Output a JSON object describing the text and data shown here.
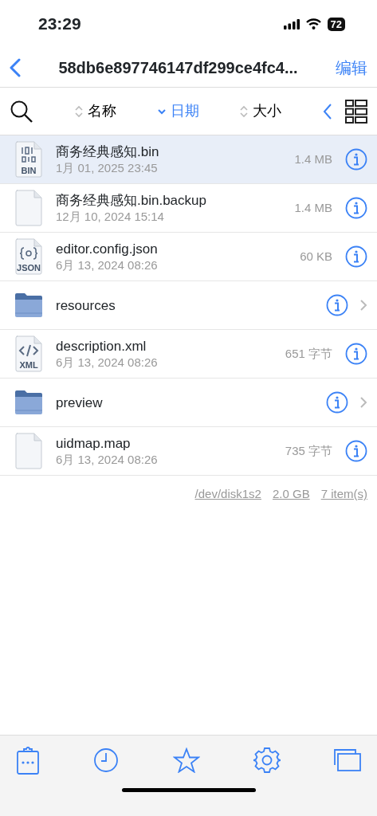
{
  "status_bar": {
    "time": "23:29",
    "battery": "72"
  },
  "nav": {
    "title": "58db6e897746147df299ce4fc4...",
    "action": "编辑"
  },
  "sort": [
    {
      "label": "名称",
      "selected": false
    },
    {
      "label": "日期",
      "selected": true
    },
    {
      "label": "大小",
      "selected": false
    }
  ],
  "files": [
    {
      "kind": "binary",
      "badge": "BIN",
      "name": "商务经典感知.bin",
      "date": "1月 01, 2025 23:45",
      "size": "1.4 MB",
      "selected": true
    },
    {
      "kind": "document",
      "name": "商务经典感知.bin.backup",
      "date": "12月 10, 2024 15:14",
      "size": "1.4 MB",
      "selected": false
    },
    {
      "kind": "json",
      "badge": "JSON",
      "name": "editor.config.json",
      "date": "6月 13, 2024 08:26",
      "size": "60 KB",
      "selected": false
    },
    {
      "kind": "folder",
      "name": "resources",
      "selected": false
    },
    {
      "kind": "xml",
      "badge": "XML",
      "name": "description.xml",
      "date": "6月 13, 2024 08:26",
      "size": "651 字节",
      "selected": false
    },
    {
      "kind": "folder",
      "name": "preview",
      "selected": false
    },
    {
      "kind": "document",
      "name": "uidmap.map",
      "date": "6月 13, 2024 08:26",
      "size": "735 字节",
      "selected": false
    }
  ],
  "footer": [
    "/dev/disk1s2",
    "2.0 GB",
    "7 item(s)"
  ]
}
